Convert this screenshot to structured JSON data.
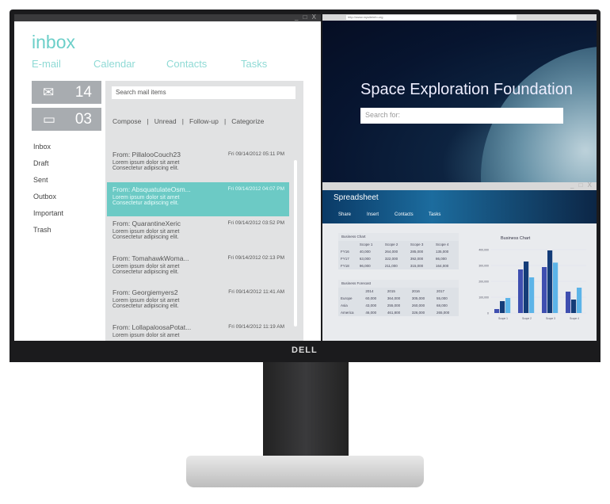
{
  "device": {
    "brand_logo": "DELL"
  },
  "mail_app": {
    "window_controls": "_ □ X",
    "title": "inbox",
    "nav": [
      "E-mail",
      "Calendar",
      "Contacts",
      "Tasks"
    ],
    "counters": [
      {
        "icon": "envelope-icon",
        "value": "14"
      },
      {
        "icon": "chat-bubble-icon",
        "value": "03"
      }
    ],
    "folders": [
      "Inbox",
      "Draft",
      "Sent",
      "Outbox",
      "Important",
      "Trash"
    ],
    "search_placeholder": "Search mail items",
    "actions": "Compose   |   Unread   |   Follow-up   |   Categorize",
    "accent": "#6ccac5",
    "messages": [
      {
        "from": "From: PillalooCouch23",
        "date": "Fri 09/14/2012 05:11 PM",
        "line1": "Lorem ipsum dolor sit amet",
        "line2": "Consectetur adipiscing elit.",
        "selected": false
      },
      {
        "from": "From: AbsquatulateOsm...",
        "date": "Fri 09/14/2012 04:07 PM",
        "line1": "Lorem ipsum dolor sit amet",
        "line2": "Consectetur adipiscing elit.",
        "selected": true
      },
      {
        "from": "From: QuarantineXeric",
        "date": "Fri 09/14/2012 03:52 PM",
        "line1": "Lorem ipsum dolor sit amet",
        "line2": "Consectetur adipiscing elit.",
        "selected": false
      },
      {
        "from": "From: TomahawkWoma...",
        "date": "Fri 09/14/2012 02:13 PM",
        "line1": "Lorem ipsum dolor sit amet",
        "line2": "Consectetur adipiscing elit.",
        "selected": false
      },
      {
        "from": "From: Georgiemyers2",
        "date": "Fri 09/14/2012 11:41 AM",
        "line1": "Lorem ipsum dolor sit amet",
        "line2": "Consectetur adipiscing elit.",
        "selected": false
      },
      {
        "from": "From: LollapaloosaPotat...",
        "date": "Fri 09/14/2012 11:19 AM",
        "line1": "Lorem ipsum dolor sit amet",
        "line2": "",
        "selected": false
      }
    ]
  },
  "browser": {
    "url": "http://www.mysiteinfo.org",
    "title": "Space Exploration Foundation",
    "search_placeholder": "Search for:"
  },
  "spreadsheet": {
    "window_controls": "_ □ X",
    "title": "Spreadsheet",
    "nav": [
      "Share",
      "Insert",
      "Contacts",
      "Tasks"
    ],
    "table1": {
      "title": "Business Chart",
      "headers": [
        "",
        "Scope 1",
        "Scope 2",
        "Scope 3",
        "Scope 4"
      ],
      "rows": [
        [
          "FY16",
          "40,000",
          "264,000",
          "285,000",
          "135,000"
        ],
        [
          "FY17",
          "63,000",
          "322,000",
          "392,000",
          "86,000"
        ],
        [
          "FY18",
          "96,000",
          "211,000",
          "315,000",
          "164,000"
        ]
      ]
    },
    "table2": {
      "title": "Business Forecast",
      "headers": [
        "",
        "2014",
        "2015",
        "2016",
        "2017"
      ],
      "rows": [
        [
          "Europe",
          "60,000",
          "364,000",
          "305,000",
          "55,000"
        ],
        [
          "Asia",
          "43,000",
          "255,000",
          "260,000",
          "68,000"
        ],
        [
          "America",
          "46,000",
          "461,800",
          "326,000",
          "265,000"
        ]
      ]
    }
  },
  "chart_data": {
    "type": "bar",
    "title": "Business Chart",
    "categories": [
      "Scope 1",
      "Scope 2",
      "Scope 3",
      "Scope 4"
    ],
    "series": [
      {
        "name": "FY16",
        "values": [
          25000,
          275000,
          290000,
          135000
        ],
        "color": "#3f4fb0"
      },
      {
        "name": "FY17",
        "values": [
          75000,
          325000,
          395000,
          85000
        ],
        "color": "#143c78"
      },
      {
        "name": "FY18",
        "values": [
          95000,
          225000,
          318000,
          160000
        ],
        "color": "#5cb4e8"
      }
    ],
    "yticks": [
      "0",
      "100,000",
      "200,000",
      "300,000",
      "400,000"
    ],
    "ylim": [
      0,
      400000
    ],
    "grid": true
  }
}
